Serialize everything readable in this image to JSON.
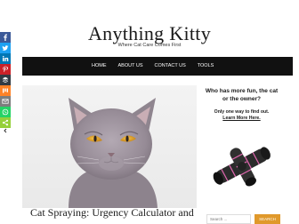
{
  "site": {
    "title": "Anything Kitty",
    "tagline": "Where Cat Care Comes First"
  },
  "nav": {
    "items": [
      {
        "label": "HOME"
      },
      {
        "label": "ABOUT US"
      },
      {
        "label": "CONTACT US"
      },
      {
        "label": "TOOLS"
      }
    ]
  },
  "share": {
    "buttons": [
      {
        "icon": "facebook-icon",
        "color": "#3b5998"
      },
      {
        "icon": "twitter-icon",
        "color": "#1da1f2"
      },
      {
        "icon": "linkedin-icon",
        "color": "#0077b5"
      },
      {
        "icon": "pinterest-icon",
        "color": "#cb2027"
      },
      {
        "icon": "buffer-icon",
        "color": "#323b43"
      },
      {
        "icon": "mix-icon",
        "color": "#ff8226"
      },
      {
        "icon": "email-icon",
        "color": "#7d7d7d"
      },
      {
        "icon": "whatsapp-icon",
        "color": "#25d366"
      },
      {
        "icon": "share-icon",
        "color": "#95d03a"
      }
    ],
    "toggle_icon": "chevron-left-icon"
  },
  "post": {
    "title": "Cat Spraying: Urgency Calculator and"
  },
  "ad": {
    "headline": "Who has more fun, the cat or the owner?",
    "sub": "Only one way to find out.",
    "link": "Learn More Here."
  },
  "search": {
    "placeholder": "Search ...",
    "button_label": "SEARCH"
  }
}
